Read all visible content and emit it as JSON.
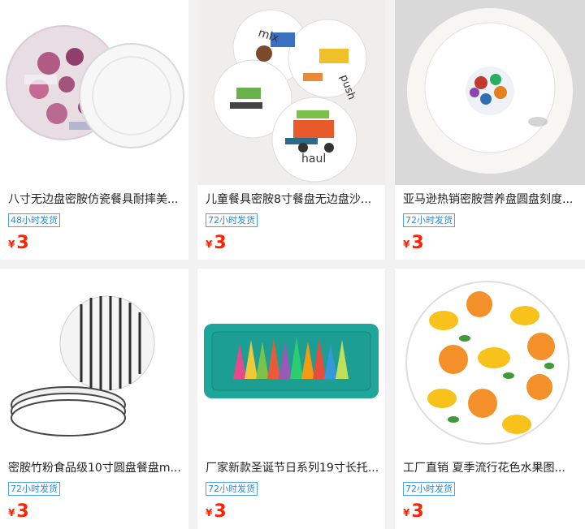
{
  "products": [
    {
      "title": "八寸无边盘密胺仿瓷餐具耐摔美...",
      "badge": "48小时发货",
      "currency": "¥",
      "price": "3"
    },
    {
      "title": "儿童餐具密胺8寸餐盘无边盘沙...",
      "badge": "72小时发货",
      "currency": "¥",
      "price": "3"
    },
    {
      "title": "亚马逊热销密胺营养盘圆盘刻度...",
      "badge": "72小时发货",
      "currency": "¥",
      "price": "3"
    },
    {
      "title": "密胺竹粉食品级10寸圆盘餐盘m...",
      "badge": "72小时发货",
      "currency": "¥",
      "price": "3"
    },
    {
      "title": "厂家新款圣诞节日系列19寸长托...",
      "badge": "72小时发货",
      "currency": "¥",
      "price": "3"
    },
    {
      "title": "工厂直销 夏季流行花色水果图...",
      "badge": "72小时发货",
      "currency": "¥",
      "price": "3"
    }
  ],
  "image_text": {
    "mix": "mix",
    "push": "push",
    "haul": "haul"
  }
}
